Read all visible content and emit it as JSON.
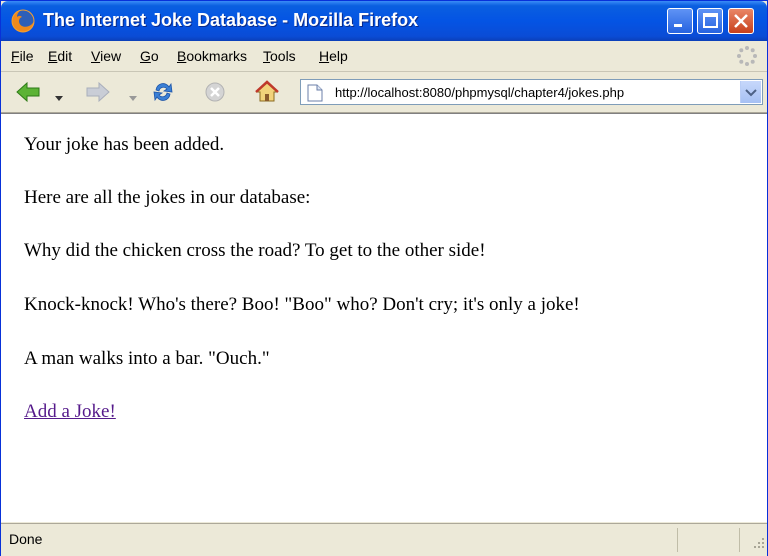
{
  "window": {
    "title": "The Internet Joke Database - Mozilla Firefox"
  },
  "menu": {
    "items": [
      {
        "key": "F",
        "rest": "ile"
      },
      {
        "key": "E",
        "rest": "dit"
      },
      {
        "key": "V",
        "rest": "iew"
      },
      {
        "key": "G",
        "rest": "o"
      },
      {
        "key": "B",
        "rest": "ookmarks"
      },
      {
        "key": "T",
        "rest": "ools"
      },
      {
        "key": "H",
        "rest": "elp"
      }
    ]
  },
  "navbar": {
    "url": "http://localhost:8080/phpmysql/chapter4/jokes.php"
  },
  "content": {
    "confirmation": "Your joke has been added.",
    "intro": "Here are all the jokes in our database:",
    "jokes": [
      "Why did the chicken cross the road? To get to the other side!",
      "Knock-knock! Who's there? Boo! \"Boo\" who? Don't cry; it's only a joke!",
      "A man walks into a bar. \"Ouch.\""
    ],
    "add_link": "Add a Joke!"
  },
  "status": {
    "text": "Done"
  },
  "colors": {
    "titlebar": "#0454e4",
    "chrome": "#ece9d8",
    "visited_link": "#551a8b"
  },
  "icons": [
    "firefox-logo-icon",
    "minimize-icon",
    "maximize-icon",
    "close-icon",
    "throbber-icon",
    "back-arrow-icon",
    "forward-arrow-icon",
    "reload-icon",
    "stop-icon",
    "home-icon",
    "page-icon",
    "dropdown-arrow-icon",
    "resize-grip-icon"
  ]
}
